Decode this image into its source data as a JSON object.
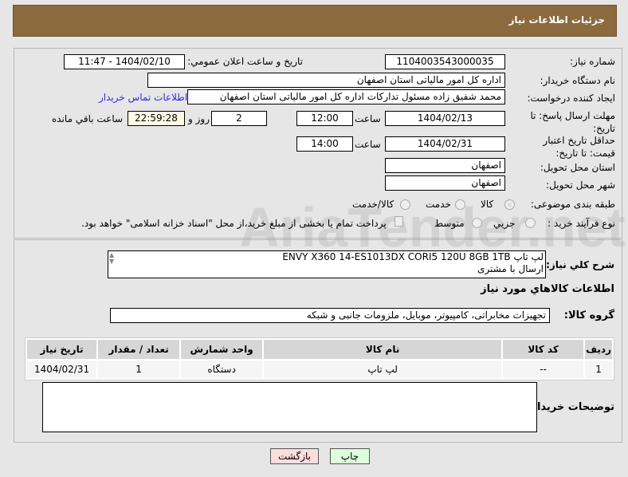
{
  "header": {
    "title": "جزئیات اطلاعات نیاز"
  },
  "fields": {
    "need_number_label": "شماره نیاز:",
    "need_number": "1104003543000035",
    "announce_label": "تاریخ و ساعت اعلان عمومي:",
    "announce": "1404/02/10 - 11:47",
    "buyer_label": "نام دستگاه خريدار:",
    "buyer": "اداره کل امور مالیاتی استان اصفهان",
    "creator_label": "ايجاد کننده درخواست:",
    "creator": "محمد شفیق زاده مسئول تدارکات اداره کل امور مالیاتی استان اصفهان",
    "contact_link": "اطلاعات تماس خريدار",
    "deadline_label": "مهلت ارسال پاسخ: تا تاریخ:",
    "deadline_date": "1404/02/13",
    "time_label": "ساعت",
    "deadline_time": "12:00",
    "days": "2",
    "days_label": "روز و",
    "remaining": "22:59:28",
    "remaining_label": "ساعت باقي مانده",
    "validity_label": "حداقل تاریخ اعتبار قیمت: تا تاریخ:",
    "validity_date": "1404/02/31",
    "validity_time": "14:00",
    "province_label": "استان محل تحویل:",
    "province": "اصفهان",
    "city_label": "شهر محل تحویل:",
    "city": "اصفهان",
    "category_label": "طبقه بندی موضوعی:",
    "category_options": [
      "کالا",
      "خدمت",
      "کالا/خدمت"
    ],
    "purchase_label": "نوع فرآیند خرید :",
    "purchase_options": [
      "جزيي",
      "متوسط"
    ],
    "payment_note": "پرداخت تمام یا بخشی از مبلغ خرید،از محل \"اسناد خزانه اسلامی\" خواهد بود."
  },
  "description": {
    "label": "شرح کلي نياز:",
    "line1": "لپ تاپ ENVY X360 14-ES1013DX CORI5 120U 8GB 1TB",
    "line2": "ارسال با مشتری"
  },
  "goods": {
    "heading": "اطلاعات کالاهاي مورد نياز",
    "group_label": "گروه کالا:",
    "group": "تجهیزات مخابراتی، کامپیوتر، موبایل، ملزومات جانبی و شبکه",
    "columns": [
      "ردیف",
      "کد کالا",
      "نام کالا",
      "واحد شمارش",
      "تعداد / مقدار",
      "تاریخ نیاز"
    ],
    "rows": [
      [
        "1",
        "--",
        "لپ تاپ",
        "دستگاه",
        "1",
        "1404/02/31"
      ]
    ]
  },
  "notes": {
    "label": "توضیحات خریدار:",
    "value": ""
  },
  "buttons": {
    "print": "چاپ",
    "back": "بازگشت"
  },
  "watermark": "AriaTender.net"
}
